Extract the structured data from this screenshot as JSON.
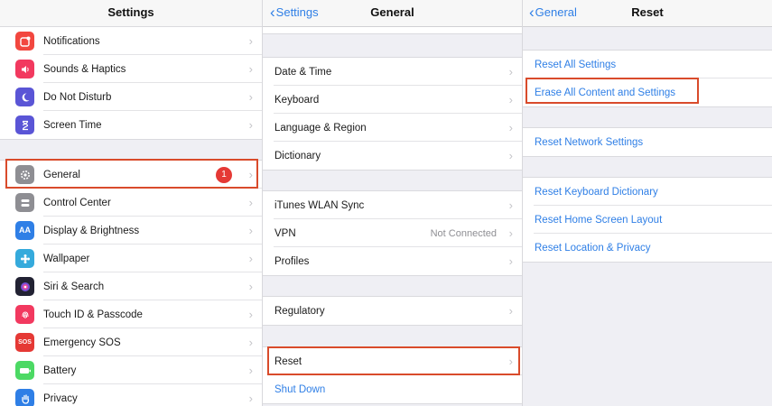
{
  "settings_panel": {
    "title": "Settings",
    "group1": [
      {
        "label": "Notifications",
        "icon": "notifications-icon",
        "color": "#f2473f"
      },
      {
        "label": "Sounds & Haptics",
        "icon": "sounds-icon",
        "color": "#f2395f"
      },
      {
        "label": "Do Not Disturb",
        "icon": "moon-icon",
        "color": "#5a55d6"
      },
      {
        "label": "Screen Time",
        "icon": "hourglass-icon",
        "color": "#5a55d6"
      }
    ],
    "group2": [
      {
        "label": "General",
        "icon": "gear-icon",
        "color": "#8e8e93",
        "badge": "1"
      },
      {
        "label": "Control Center",
        "icon": "switches-icon",
        "color": "#8e8e93"
      },
      {
        "label": "Display & Brightness",
        "icon": "display-icon",
        "color": "#2f7fe6",
        "glyph": "AA"
      },
      {
        "label": "Wallpaper",
        "icon": "wallpaper-icon",
        "color": "#35aadc"
      },
      {
        "label": "Siri & Search",
        "icon": "siri-icon",
        "color": "#222233"
      },
      {
        "label": "Touch ID & Passcode",
        "icon": "fingerprint-icon",
        "color": "#f2395f"
      },
      {
        "label": "Emergency SOS",
        "icon": "sos-icon",
        "color": "#e53935",
        "glyph": "SOS"
      },
      {
        "label": "Battery",
        "icon": "battery-icon",
        "color": "#4cd964"
      },
      {
        "label": "Privacy",
        "icon": "hand-icon",
        "color": "#2f7fe6"
      }
    ]
  },
  "general_panel": {
    "title": "General",
    "back_label": "Settings",
    "group1": [
      {
        "label": "Date & Time"
      },
      {
        "label": "Keyboard"
      },
      {
        "label": "Language & Region"
      },
      {
        "label": "Dictionary"
      }
    ],
    "group2": [
      {
        "label": "iTunes WLAN Sync"
      },
      {
        "label": "VPN",
        "detail": "Not Connected"
      },
      {
        "label": "Profiles"
      }
    ],
    "group3": [
      {
        "label": "Regulatory"
      }
    ],
    "group4": [
      {
        "label": "Reset"
      },
      {
        "label": "Shut Down"
      }
    ]
  },
  "reset_panel": {
    "title": "Reset",
    "back_label": "General",
    "group1": [
      {
        "label": "Reset All Settings"
      },
      {
        "label": "Erase All Content and Settings"
      }
    ],
    "group2": [
      {
        "label": "Reset Network Settings"
      }
    ],
    "group3": [
      {
        "label": "Reset Keyboard Dictionary"
      },
      {
        "label": "Reset Home Screen Layout"
      },
      {
        "label": "Reset Location & Privacy"
      }
    ]
  },
  "colors": {
    "accent": "#2f7fe6",
    "highlight": "#d94b2b",
    "badge": "#e53935"
  }
}
